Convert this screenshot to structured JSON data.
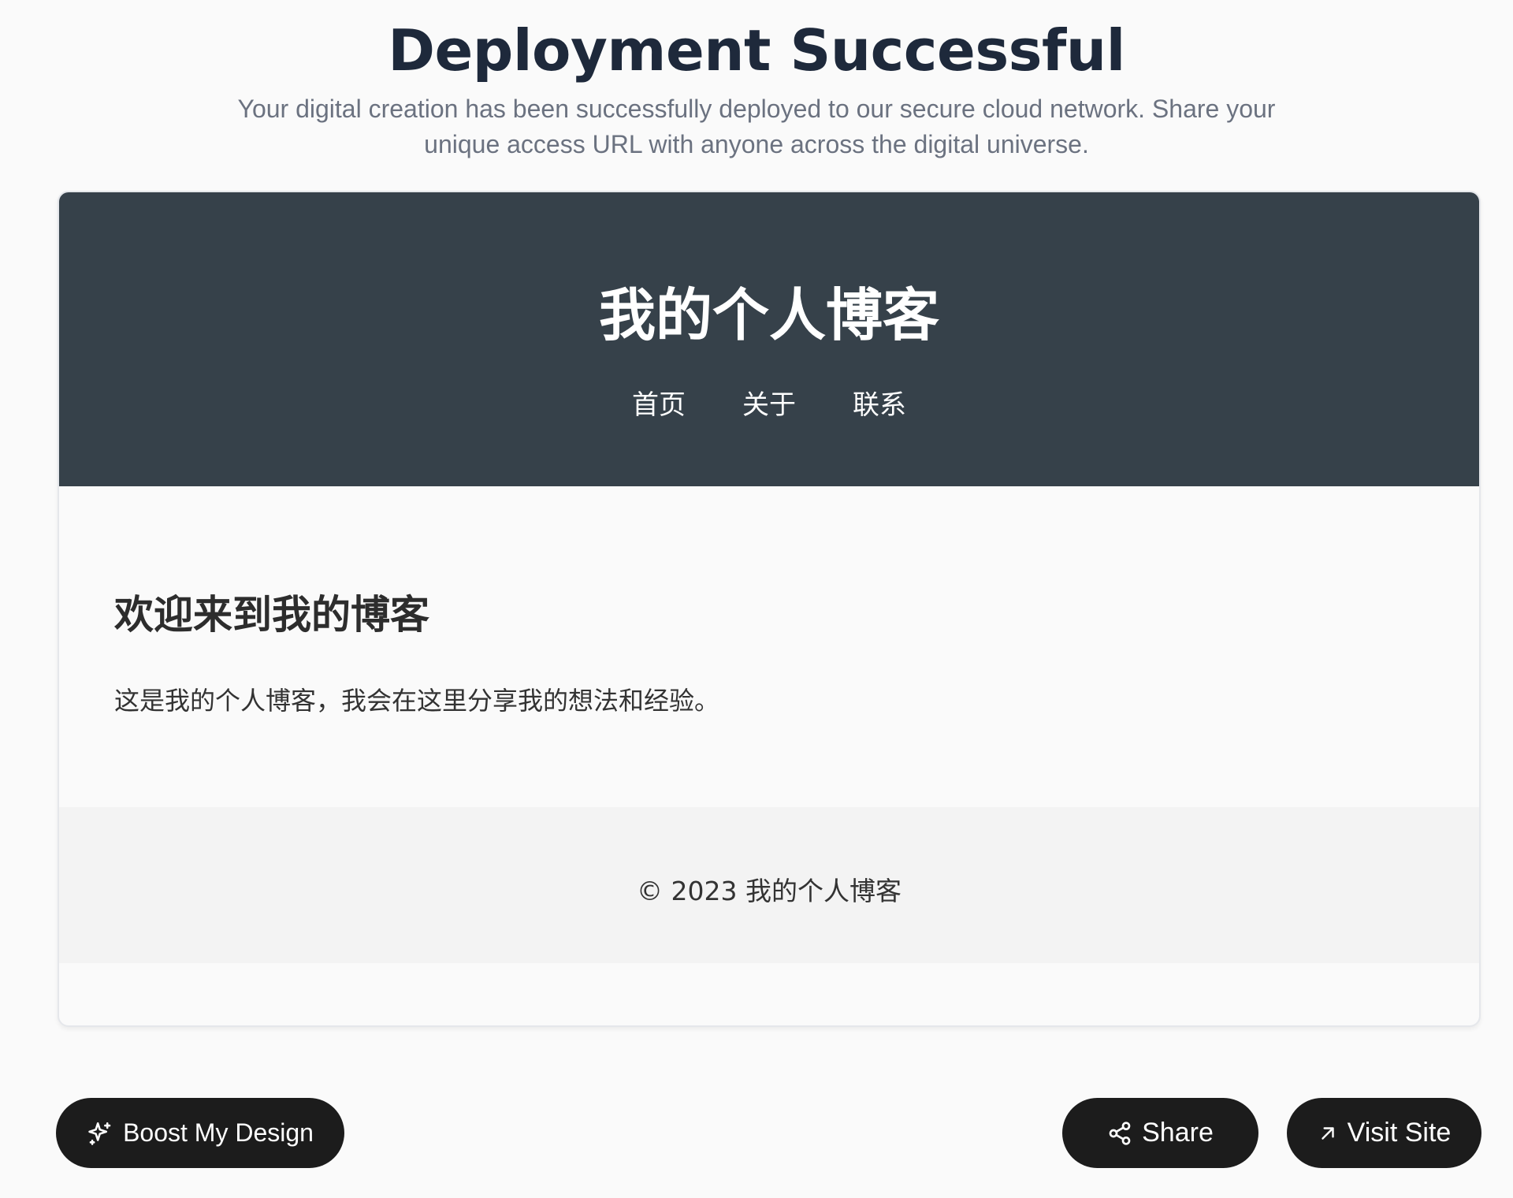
{
  "header": {
    "title": "Deployment Successful",
    "subtitle": "Your digital creation has been successfully deployed to our secure cloud network. Share your unique access URL with anyone across the digital universe."
  },
  "preview": {
    "blog_title": "我的个人博客",
    "nav": [
      "首页",
      "关于",
      "联系"
    ],
    "welcome_heading": "欢迎来到我的博客",
    "welcome_text": "这是我的个人博客，我会在这里分享我的想法和经验。",
    "footer_text": "© 2023 我的个人博客"
  },
  "actions": {
    "boost_label": "Boost My Design",
    "boost_icon": "sparkles-icon",
    "share_label": "Share",
    "share_icon": "share-icon",
    "visit_label": "Visit Site",
    "visit_icon": "arrow-up-right-icon"
  },
  "colors": {
    "background": "#fafafa",
    "title": "#1e293b",
    "subtitle": "#6b7280",
    "blog_header": "#36414a",
    "blog_footer": "#f3f3f3",
    "button": "#1c1c1c"
  }
}
